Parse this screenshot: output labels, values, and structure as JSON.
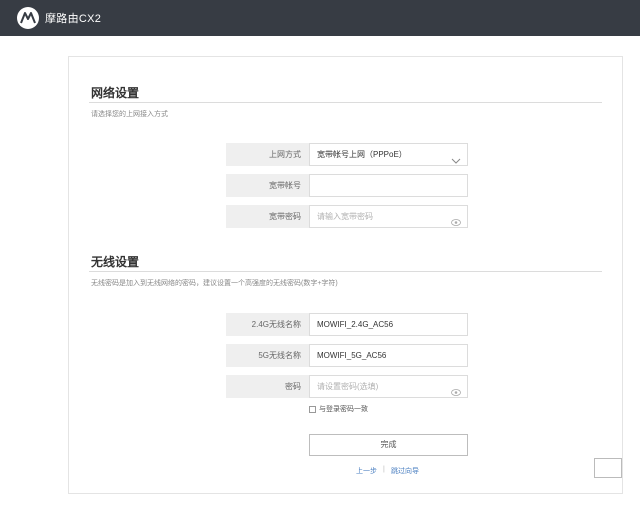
{
  "header": {
    "brand": "摩路由CX2",
    "logo_icon": "motorola-logo-icon"
  },
  "network": {
    "title": "网络设置",
    "desc": "请选择您的上网接入方式",
    "conn_type_label": "上网方式",
    "conn_type_value": "宽带帐号上网（PPPoE）",
    "account_label": "宽带帐号",
    "account_value": "",
    "password_label": "宽带密码",
    "password_placeholder": "请输入宽带密码"
  },
  "wireless": {
    "title": "无线设置",
    "desc": "无线密码是加入到无线网络的密码，建议设置一个高强度的无线密码(数字+字符)",
    "ssid24_label": "2.4G无线名称",
    "ssid24_value": "MOWIFI_2.4G_AC56",
    "ssid5_label": "5G无线名称",
    "ssid5_value": "MOWIFI_5G_AC56",
    "wpass_label": "密码",
    "wpass_placeholder": "请设置密码(选填)",
    "same_pass_label": "与登录密码一致",
    "same_pass_checked": false
  },
  "actions": {
    "done_label": "完成",
    "prev_label": "上一步",
    "sep": "|",
    "skip_label": "跳过向导"
  },
  "colors": {
    "topbar": "#373c44",
    "link": "#4a7fc1",
    "label_bg": "#efefef"
  }
}
